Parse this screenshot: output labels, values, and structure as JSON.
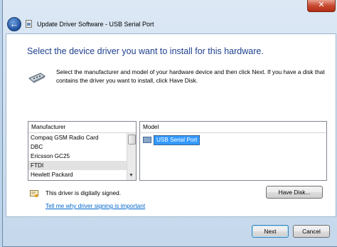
{
  "window": {
    "title": "Update Driver Software - USB Serial Port",
    "close_label": "✕",
    "back_label": "←"
  },
  "main": {
    "heading": "Select the device driver you want to install for this hardware.",
    "description": "Select the manufacturer and model of your hardware device and then click Next. If you have a disk that contains the driver you want to install, click Have Disk."
  },
  "manufacturer": {
    "header": "Manufacturer",
    "items": [
      {
        "label": "Compaq GSM Radio Card",
        "selected": false
      },
      {
        "label": "DBC",
        "selected": false
      },
      {
        "label": "Ericsson GC25",
        "selected": false
      },
      {
        "label": "FTDI",
        "selected": true
      },
      {
        "label": "Hewlett Packard",
        "selected": false
      }
    ]
  },
  "model": {
    "header": "Model",
    "items": [
      {
        "label": "USB Serial Port",
        "selected": true
      }
    ]
  },
  "signing": {
    "status": "This driver is digitally signed.",
    "link": "Tell me why driver signing is important"
  },
  "buttons": {
    "have_disk": "Have Disk...",
    "next": "Next",
    "cancel": "Cancel"
  },
  "colors": {
    "heading": "#1e3f8f",
    "link": "#0066cc",
    "selection": "#3399ff",
    "close_button": "#c74a31"
  },
  "icons": {
    "back": "back-arrow-icon",
    "title": "wizard-icon",
    "driver": "serial-cable-icon",
    "signed": "signed-certificate-icon",
    "model": "port-icon"
  }
}
